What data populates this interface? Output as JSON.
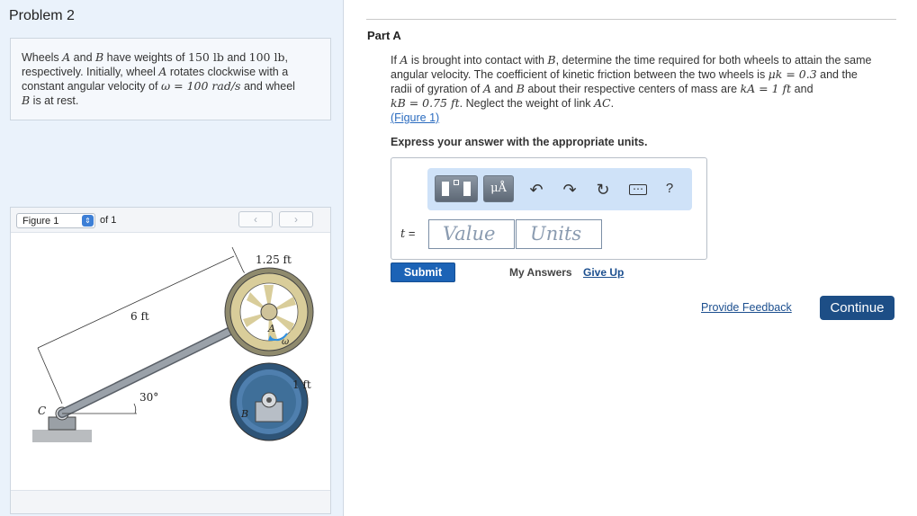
{
  "problem": {
    "title": "Problem 2",
    "statement": {
      "l1_a": "Wheels ",
      "A": "A",
      "l1_b": " and ",
      "B": "B",
      "l1_c": " have weights of ",
      "w1": "150 lb",
      "l1_d": " and ",
      "w2": "100 lb",
      "l1_e": ",",
      "l2": "respectively. Initially, wheel ",
      "l2_b": " rotates clockwise with a",
      "l3": "constant angular velocity of ",
      "omega_eq": "ω = 100 rad/s",
      "l3_b": " and wheel",
      "l4": " is at rest."
    }
  },
  "figure": {
    "select_label": "Figure 1",
    "of_label": "of 1",
    "prev_icon": "chevron-left-icon",
    "next_icon": "chevron-right-icon",
    "labels": {
      "r_a": "1.25 ft",
      "len": "6 ft",
      "angle": "30°",
      "r_b": "1 ft",
      "c": "C",
      "a": "A",
      "b": "B",
      "omega": "ω"
    },
    "colors": {
      "wheel_a": "#d9cd9a",
      "wheel_b": "#3f6f99",
      "link": "#8d949c",
      "arrow": "#2f8fe0"
    }
  },
  "part": {
    "title": "Part A",
    "q1": "If ",
    "q1_A": "A",
    "q1_b": " is brought into contact with ",
    "q1_B": "B",
    "q1_c": ", determine the time required for both wheels to attain the same",
    "q2": "angular velocity. The coefficient of kinetic friction between the two wheels is ",
    "mu": "μk = 0.3",
    "q2_b": " and the",
    "q3": "radii of gyration of ",
    "q3_A": "A",
    "q3_b": " and ",
    "q3_B": "B",
    "q3_c": " about their respective centers of mass are ",
    "kA": "kA = 1 ft",
    "q3_d": " and",
    "q4_kB": "kB = 0.75 ft",
    "q4_b": ". Neglect the weight of link ",
    "q4_AC": "AC",
    "q4_c": ".",
    "fig_link": "(Figure 1)",
    "instruction": "Express your answer with the appropriate units."
  },
  "answer": {
    "variable": "t",
    "equals": " =",
    "value_placeholder": "Value",
    "units_placeholder": "Units",
    "toolbar_icons": [
      "templates-icon",
      "units-icon",
      "undo-icon",
      "redo-icon",
      "reset-icon",
      "keyboard-icon",
      "help-icon"
    ],
    "units_label": "μÅ",
    "help_label": "?"
  },
  "actions": {
    "submit": "Submit",
    "my_answers": "My Answers",
    "give_up": "Give Up",
    "feedback": "Provide Feedback",
    "continue": "Continue"
  }
}
